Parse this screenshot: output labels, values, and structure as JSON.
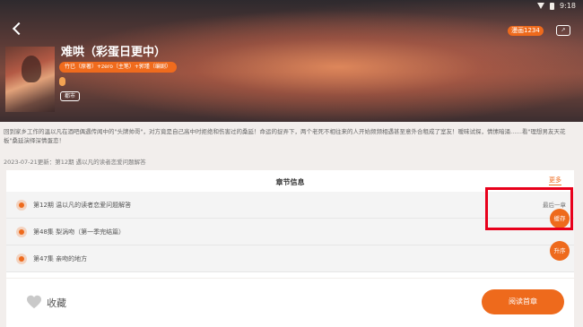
{
  "status": {
    "time": "9:18"
  },
  "header": {
    "views_badge": "漫画1234"
  },
  "comic": {
    "title": "难哄（彩蛋日更中）",
    "authors": "竹已（原著）+zero（主笔）+郭瑾（编剧）",
    "genre": "都市",
    "description": "回到家乡工作的温以凡在酒吧偶遇传闻中的\"头牌帅哥\"，对方竟是自己高中时拒绝和伤害过的桑延！命运的捉弄下，两个老死不相往来的人开始频频相遇甚至意外合租成了室友！暧昧试探，情愫暗涌……看\"理想男友天花板\"桑延演绎深情蛋恋！",
    "update_line": "2023-07-21更新：第12期 遇以凡的读者恋爱问题解答"
  },
  "chapters": {
    "section_title": "章节信息",
    "more_label": "更多",
    "items": [
      {
        "title": "第12期 温以凡的读者恋爱问题解答",
        "tag": "最后一章"
      },
      {
        "title": "第48集 梨涡吻（第一季完结篇）",
        "tag": ""
      },
      {
        "title": "第47集 亲吻的地方",
        "tag": ""
      }
    ]
  },
  "floating": {
    "cache_label": "缓存",
    "order_label": "升序"
  },
  "bottom_bar": {
    "favorite_label": "收藏",
    "read_label": "阅读首章"
  },
  "colors": {
    "accent": "#ee6a1c",
    "highlight_box": "#e8001b"
  }
}
